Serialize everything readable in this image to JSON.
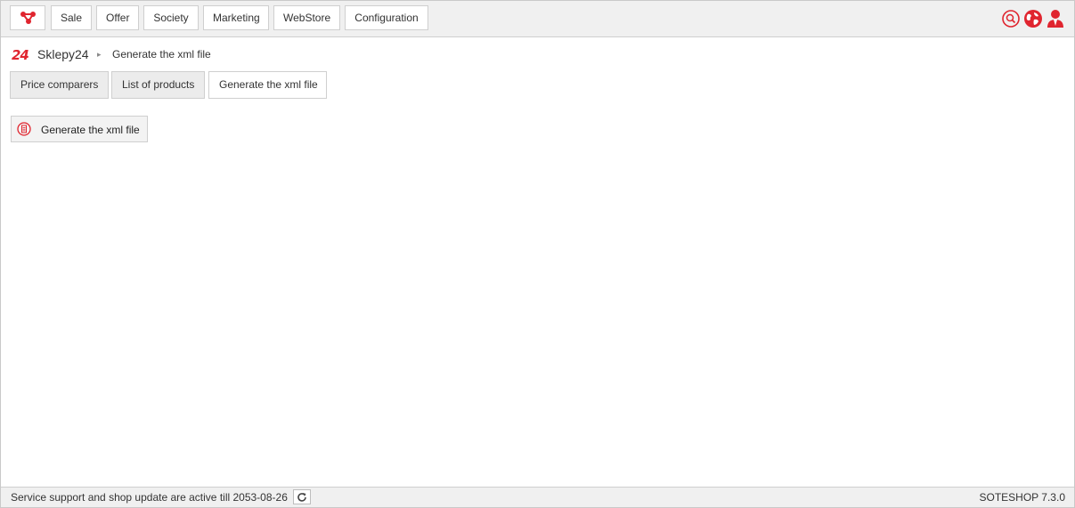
{
  "topnav": {
    "items": [
      {
        "label": "Sale"
      },
      {
        "label": "Offer"
      },
      {
        "label": "Society"
      },
      {
        "label": "Marketing"
      },
      {
        "label": "WebStore"
      },
      {
        "label": "Configuration"
      }
    ],
    "icons": [
      "search-icon",
      "globe-icon",
      "user-icon"
    ]
  },
  "breadcrumb": {
    "logo": "24",
    "shop": "Sklepy24",
    "separator": "▸",
    "current": "Generate the xml file"
  },
  "tabs": [
    {
      "label": "Price comparers",
      "active": false
    },
    {
      "label": "List of products",
      "active": false
    },
    {
      "label": "Generate the xml file",
      "active": true
    }
  ],
  "action": {
    "label": "Generate the xml file",
    "icon": "document-icon"
  },
  "footer": {
    "support_text": "Service support and shop update are active till 2053-08-26",
    "version": "SOTESHOP 7.3.0"
  },
  "colors": {
    "accent": "#e0252f",
    "bar": "#f0f0f0",
    "border": "#cfcfcf"
  }
}
